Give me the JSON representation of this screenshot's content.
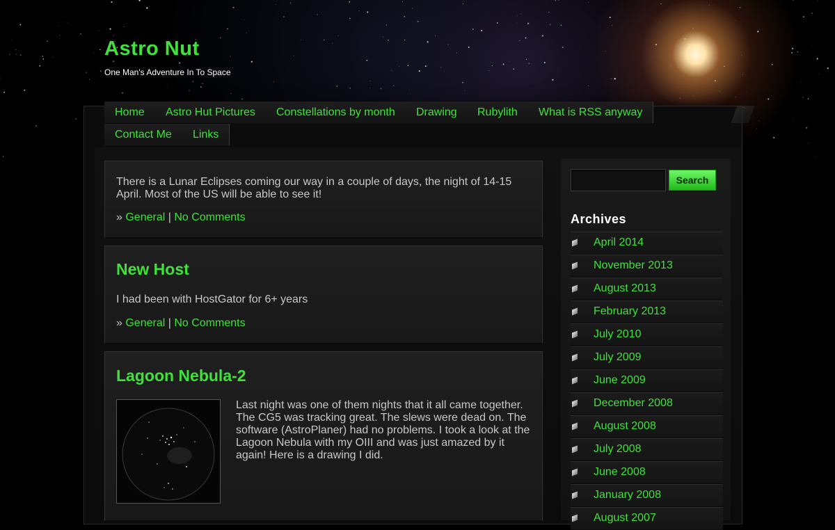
{
  "site": {
    "title": "Astro Nut",
    "tagline": "One Man's Adventure In To Space"
  },
  "nav": {
    "items": [
      "Home",
      "Astro Hut Pictures",
      "Constellations by month",
      "Drawing",
      "Rubylith",
      "What is RSS anyway",
      "Contact Me",
      "Links"
    ]
  },
  "posts": [
    {
      "title": "",
      "body": "There is a Lunar Eclipses coming our way in a couple of days, the night of 14-15 April. Most of the US will be able to see it!",
      "meta_prefix": "»",
      "category": "General",
      "separator": "|",
      "comments": "No Comments"
    },
    {
      "title": "New Host",
      "body": "I had been with HostGator for 6+ years",
      "meta_prefix": "»",
      "category": "General",
      "separator": "|",
      "comments": "No Comments"
    },
    {
      "title": "Lagoon Nebula-2",
      "body": "Last night was one of them nights that it all came together. The CG5 was tracking great. The slews were dead on. The software (AstroPlaner) had no problems. I took a look at the Lagoon Nebula with my OIII and was just amazed by it again! Here is a drawing I did."
    }
  ],
  "sidebar": {
    "search_button": "Search",
    "archives_title": "Archives",
    "archives": [
      "April 2014",
      "November 2013",
      "August 2013",
      "February 2013",
      "July 2010",
      "July 2009",
      "June 2009",
      "December 2008",
      "August 2008",
      "July 2008",
      "June 2008",
      "January 2008",
      "August 2007"
    ]
  },
  "colors": {
    "accent_green": "#3fe23a",
    "background": "#000000",
    "text": "#c8c8c8"
  },
  "icons": {
    "archive_bullet": "bullet-arrow-icon",
    "search_button": "search-button"
  }
}
